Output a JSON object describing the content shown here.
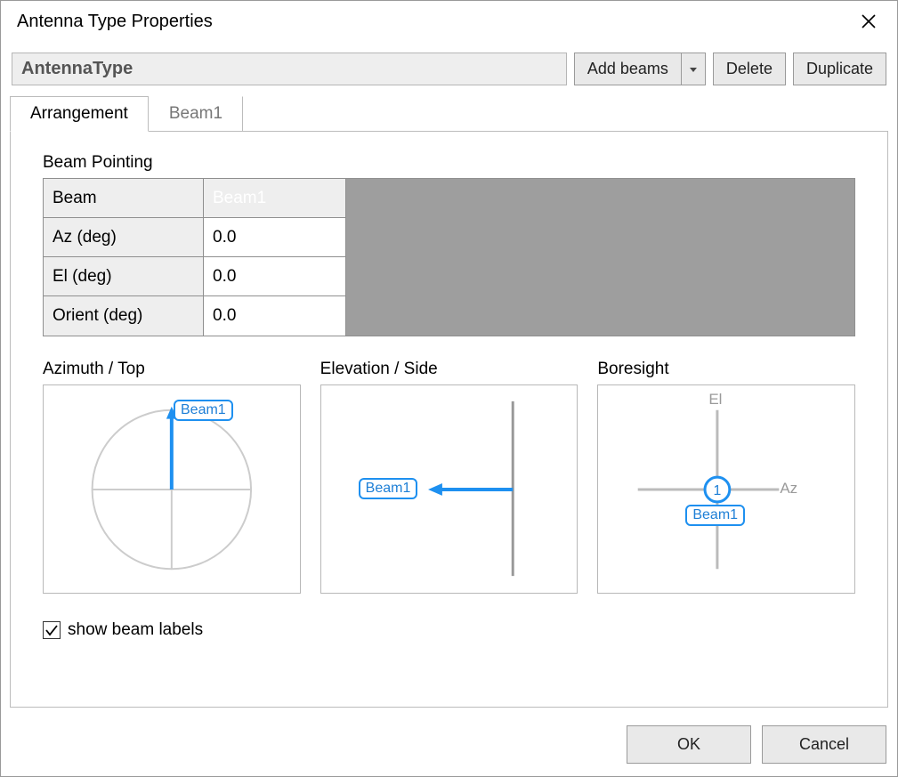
{
  "window": {
    "title": "Antenna Type Properties"
  },
  "name": "AntennaType",
  "toolbar": {
    "add_beams_label": "Add beams",
    "delete_label": "Delete",
    "duplicate_label": "Duplicate"
  },
  "tabs": [
    {
      "label": "Arrangement",
      "active": true
    },
    {
      "label": "Beam1",
      "active": false
    }
  ],
  "beam_pointing": {
    "title": "Beam Pointing",
    "rows": [
      {
        "label": "Beam",
        "value": "Beam1",
        "selected": true
      },
      {
        "label": "Az (deg)",
        "value": "0.0"
      },
      {
        "label": "El (deg)",
        "value": "0.0"
      },
      {
        "label": "Orient (deg)",
        "value": "0.0"
      }
    ]
  },
  "diagrams": {
    "azimuth": {
      "title": "Azimuth / Top",
      "beam_label": "Beam1"
    },
    "elevation": {
      "title": "Elevation / Side",
      "beam_label": "Beam1"
    },
    "boresight": {
      "title": "Boresight",
      "el_label": "El",
      "az_label": "Az",
      "marker": "1",
      "beam_label": "Beam1"
    }
  },
  "checkbox": {
    "label": "show beam labels",
    "checked": true
  },
  "footer": {
    "ok_label": "OK",
    "cancel_label": "Cancel"
  }
}
